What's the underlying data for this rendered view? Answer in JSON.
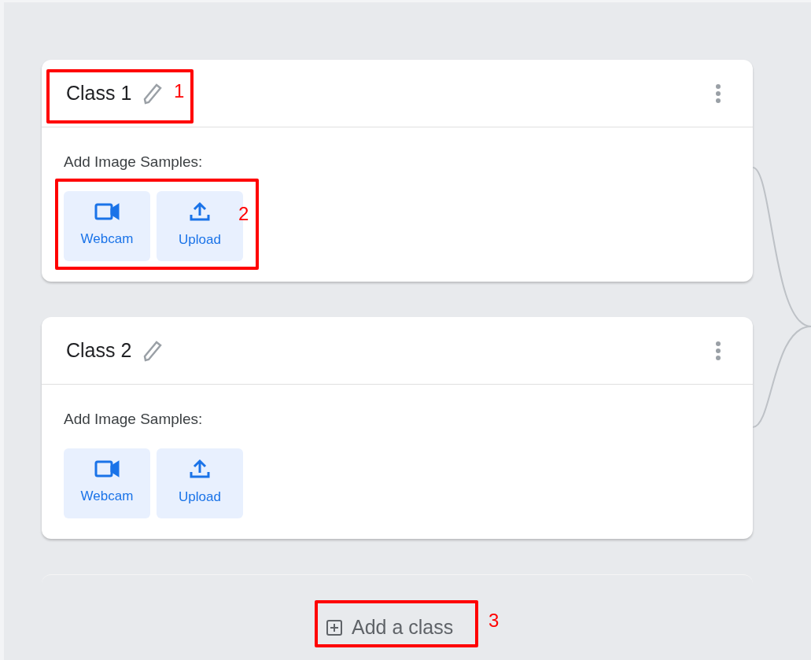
{
  "classes": [
    {
      "title": "Class 1",
      "samples_label": "Add Image Samples:",
      "buttons": [
        {
          "kind": "webcam",
          "label": "Webcam"
        },
        {
          "kind": "upload",
          "label": "Upload"
        }
      ]
    },
    {
      "title": "Class 2",
      "samples_label": "Add Image Samples:",
      "buttons": [
        {
          "kind": "webcam",
          "label": "Webcam"
        },
        {
          "kind": "upload",
          "label": "Upload"
        }
      ]
    }
  ],
  "add_class_button": {
    "label": "Add a class"
  },
  "annotations": [
    {
      "number": "1"
    },
    {
      "number": "2"
    },
    {
      "number": "3"
    }
  ]
}
